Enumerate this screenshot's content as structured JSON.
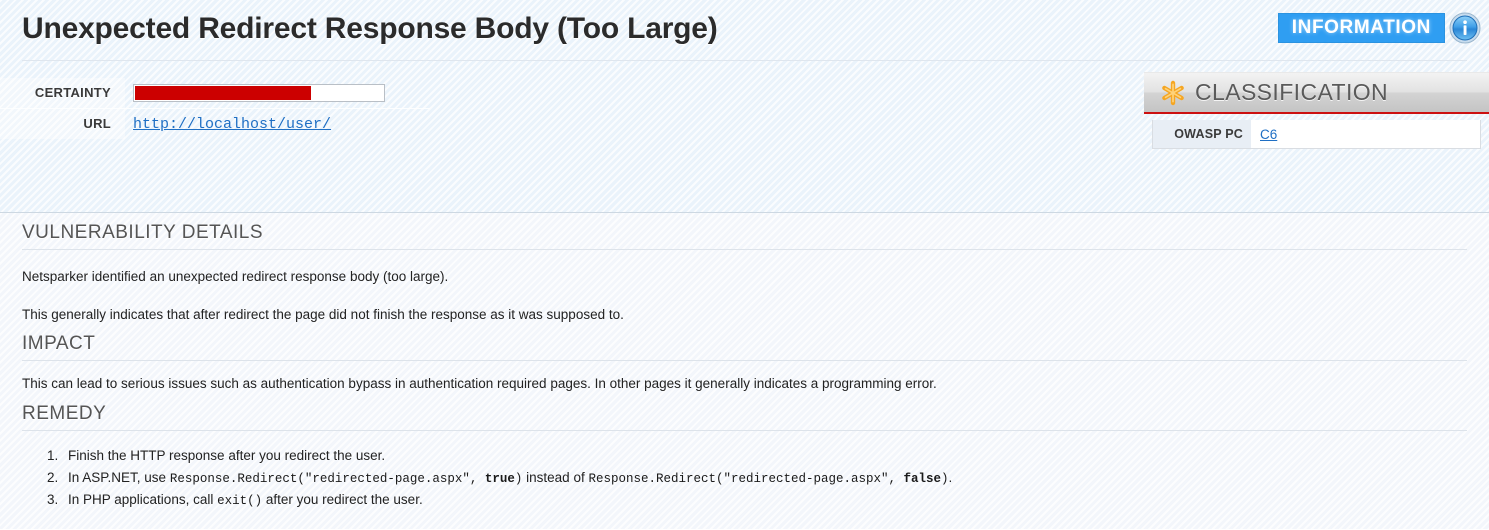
{
  "report": {
    "title": "Unexpected Redirect Response Body (Too Large)",
    "severity_label": "INFORMATION",
    "severity_color": "#2f9ef2",
    "severity_icon": "information-circle-icon"
  },
  "meta": {
    "certainty_label": "CERTAINTY",
    "certainty_percent": 71,
    "certainty_fill_color": "#cc0000",
    "url_label": "URL",
    "url_value": "http://localhost/user/"
  },
  "classification": {
    "panel_title": "CLASSIFICATION",
    "panel_icon": "orange-asterisk-icon",
    "accent_color": "#cc1111",
    "rows": [
      {
        "label": "OWASP PC",
        "value": "C6"
      }
    ]
  },
  "sections": {
    "details": {
      "heading": "VULNERABILITY DETAILS",
      "paragraphs": [
        "Netsparker identified an unexpected redirect response body (too large).",
        "This generally indicates that after redirect the page did not finish the response as it was supposed to."
      ]
    },
    "impact": {
      "heading": "IMPACT",
      "paragraphs": [
        "This can lead to serious issues such as authentication bypass in authentication required pages. In other pages it generally indicates a programming error."
      ]
    },
    "remedy": {
      "heading": "REMEDY",
      "items": [
        {
          "prefix": "Finish the HTTP response after you redirect the user.",
          "code1": "",
          "code1_bold": "",
          "code1_suffix": "",
          "middle": "",
          "code2": "",
          "code2_bold": "",
          "code2_suffix": "",
          "suffix": ""
        },
        {
          "prefix": "In ASP.NET, use ",
          "code1": "Response.Redirect(\"redirected-page.aspx\", ",
          "code1_bold": "true",
          "code1_suffix": ")",
          "middle": " instead of ",
          "code2": "Response.Redirect(\"redirected-page.aspx\", ",
          "code2_bold": "false",
          "code2_suffix": ")",
          "suffix": "."
        },
        {
          "prefix": "In PHP applications, call ",
          "code1": "exit()",
          "code1_bold": "",
          "code1_suffix": "",
          "middle": " after you redirect the user.",
          "code2": "",
          "code2_bold": "",
          "code2_suffix": "",
          "suffix": ""
        }
      ]
    }
  }
}
